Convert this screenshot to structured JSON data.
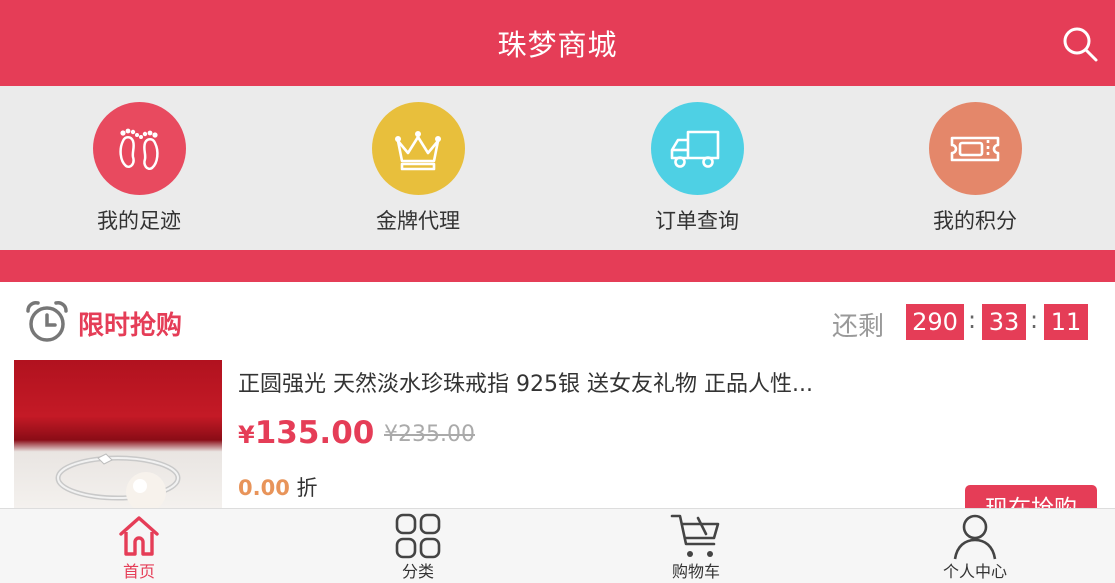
{
  "header": {
    "title": "珠梦商城",
    "search_icon": "search-icon"
  },
  "quick_nav": [
    {
      "label": "我的足迹",
      "icon": "footprints-icon",
      "color": "#e84a5f"
    },
    {
      "label": "金牌代理",
      "icon": "crown-icon",
      "color": "#e8bf3c"
    },
    {
      "label": "订单查询",
      "icon": "truck-icon",
      "color": "#4ed0e4"
    },
    {
      "label": "我的积分",
      "icon": "ticket-icon",
      "color": "#e4876a"
    }
  ],
  "flash_sale": {
    "title": "限时抢购",
    "remain_label": "还剩",
    "countdown": {
      "hours": "290",
      "minutes": "33",
      "seconds": "11",
      "separator": ":"
    },
    "product": {
      "name": "正圆强光 天然淡水珍珠戒指 925银 送女友礼物 正品人性...",
      "currency": "¥",
      "price": "135.00",
      "original_price": "¥235.00",
      "discount_value": "0.00",
      "discount_unit": "折",
      "buy_label": "现在抢购"
    }
  },
  "tabbar": {
    "items": [
      {
        "label": "首页",
        "icon": "home-icon",
        "active": true
      },
      {
        "label": "分类",
        "icon": "category-grid-icon",
        "active": false
      },
      {
        "label": "购物车",
        "icon": "cart-icon",
        "active": false
      },
      {
        "label": "个人中心",
        "icon": "user-icon",
        "active": false
      }
    ]
  },
  "colors": {
    "accent": "#e53d57",
    "nav_bg": "#ebebeb",
    "discount": "#e8945a"
  }
}
